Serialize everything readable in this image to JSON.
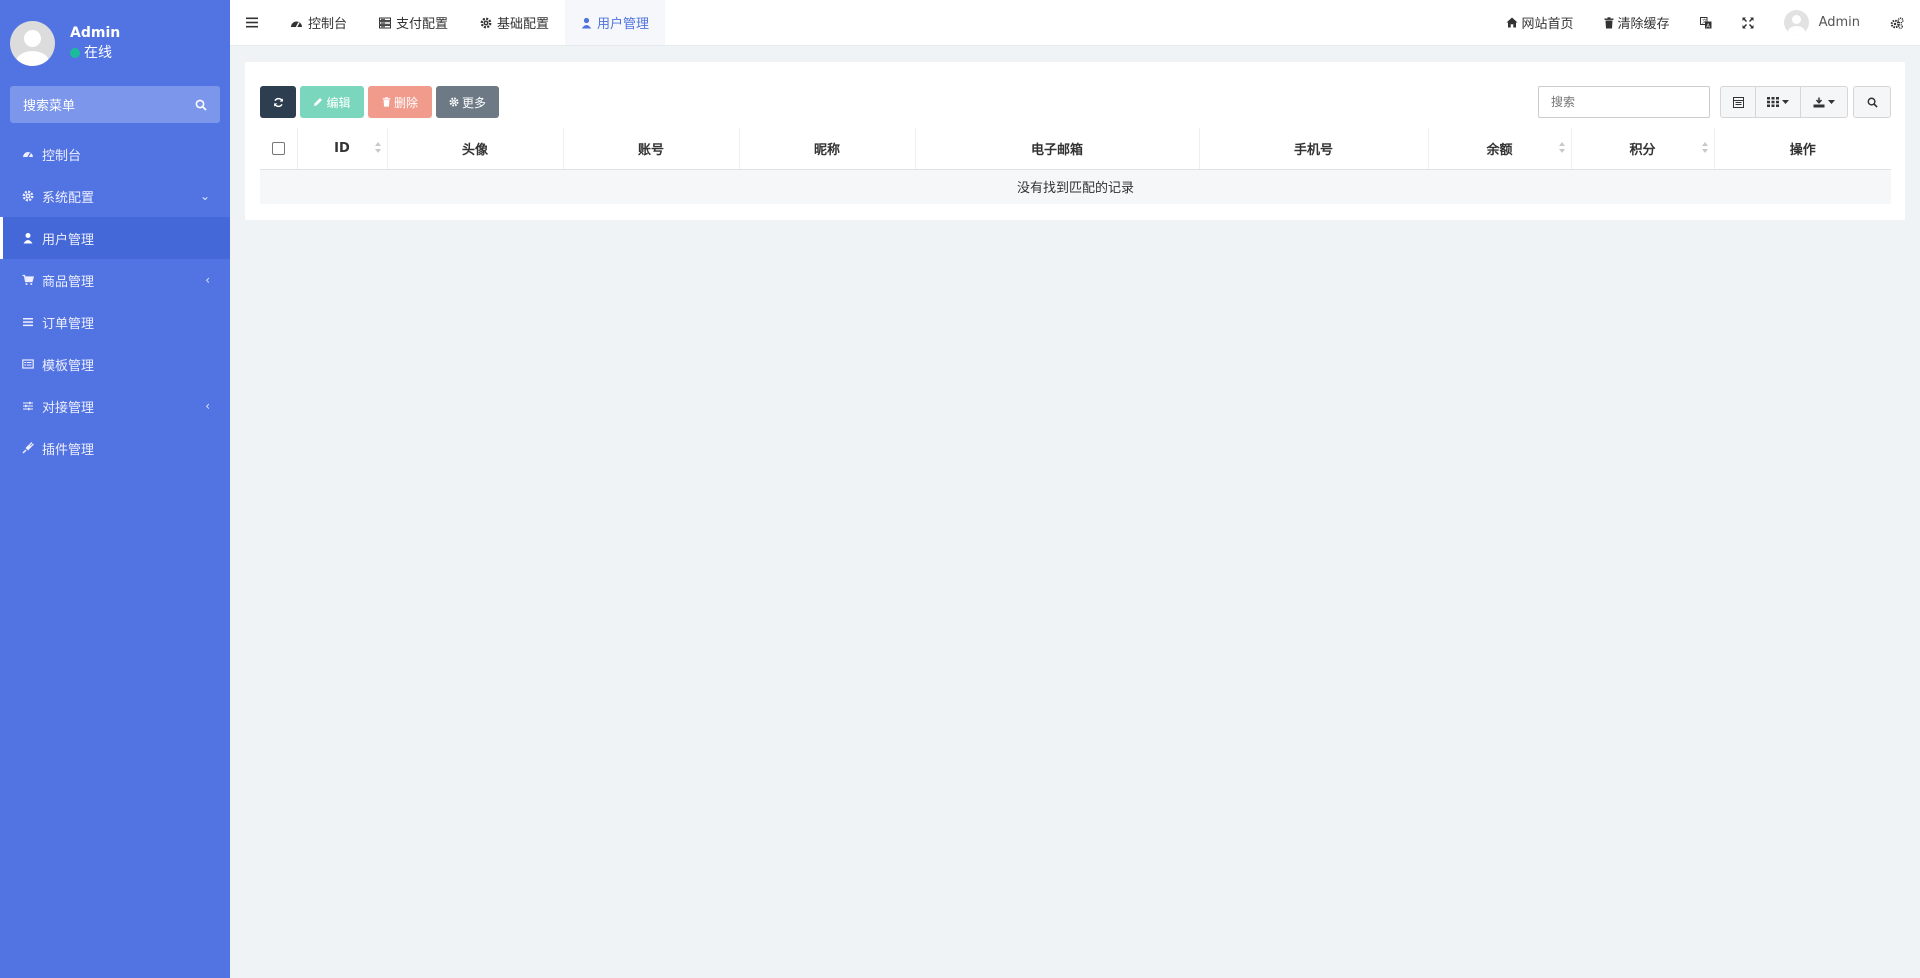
{
  "user": {
    "name": "Admin",
    "status": "在线"
  },
  "sidebar": {
    "search_placeholder": "搜索菜单",
    "items": [
      {
        "label": "控制台",
        "icon": "dashboard-icon",
        "arrow": ""
      },
      {
        "label": "系统配置",
        "icon": "gear-icon",
        "arrow": "⌄"
      },
      {
        "label": "用户管理",
        "icon": "user-icon",
        "arrow": ""
      },
      {
        "label": "商品管理",
        "icon": "cart-icon",
        "arrow": "‹"
      },
      {
        "label": "订单管理",
        "icon": "list-icon",
        "arrow": ""
      },
      {
        "label": "模板管理",
        "icon": "template-icon",
        "arrow": ""
      },
      {
        "label": "对接管理",
        "icon": "sliders-icon",
        "arrow": "‹"
      },
      {
        "label": "插件管理",
        "icon": "plug-icon",
        "arrow": ""
      }
    ]
  },
  "topbar": {
    "tabs": [
      {
        "label": "控制台",
        "icon": "dashboard-icon"
      },
      {
        "label": "支付配置",
        "icon": "server-icon"
      },
      {
        "label": "基础配置",
        "icon": "gear-icon"
      },
      {
        "label": "用户管理",
        "icon": "user-icon"
      }
    ],
    "home_label": "网站首页",
    "clear_cache_label": "清除缓存",
    "admin_label": "Admin"
  },
  "toolbar": {
    "edit_label": "编辑",
    "delete_label": "删除",
    "more_label": "更多",
    "search_placeholder": "搜索"
  },
  "table": {
    "columns": [
      "ID",
      "头像",
      "账号",
      "昵称",
      "电子邮箱",
      "手机号",
      "余额",
      "积分",
      "操作"
    ],
    "empty_message": "没有找到匹配的记录"
  },
  "colors": {
    "sidebar": "#5174e2",
    "accent": "#4e73df",
    "online": "#1abc9c",
    "edit": "#7ad7bd",
    "delete": "#f09b8c",
    "more": "#6d7a86",
    "refresh": "#2c3e50"
  }
}
